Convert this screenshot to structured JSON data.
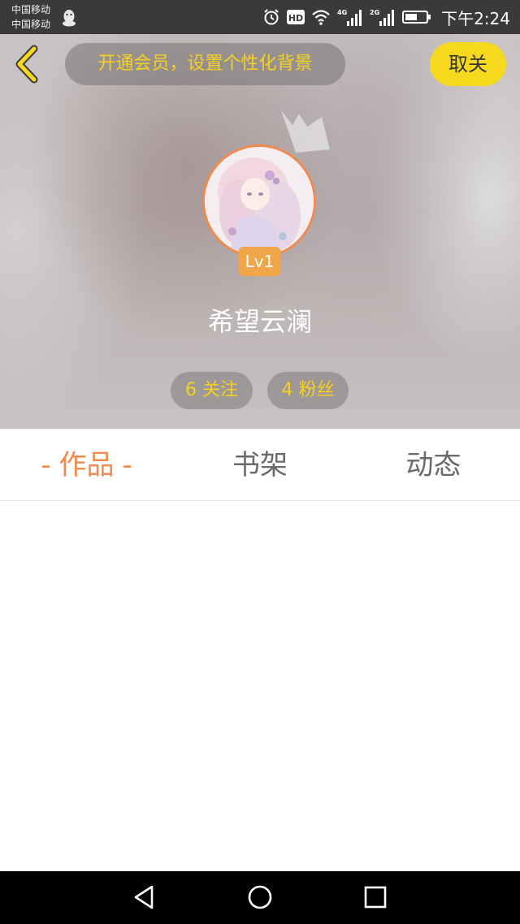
{
  "status_bar": {
    "carrier_1": "中国移动",
    "carrier_2": "中国移动",
    "network_1": "4G",
    "network_2": "2G",
    "hd": "HD",
    "time": "下午2:24"
  },
  "header": {
    "promo_text": "开通会员，设置个性化背景",
    "unfollow_label": "取关",
    "level": "Lv1",
    "username": "希望云澜",
    "following_label": "6 关注",
    "fans_label": "4 粉丝"
  },
  "tabs": [
    {
      "label": "作品",
      "active": true
    },
    {
      "label": "书架",
      "active": false
    },
    {
      "label": "动态",
      "active": false
    }
  ],
  "tab_dash": "-",
  "colors": {
    "accent_orange": "#f08a4e",
    "accent_yellow": "#f6d81d",
    "promo_text": "#f5d21f",
    "badge": "#f2a64a"
  },
  "icons": {
    "back": "chevron-left-icon",
    "crown": "crown-icon",
    "nav_back": "triangle-back-icon",
    "nav_home": "circle-home-icon",
    "nav_recent": "square-recent-icon"
  }
}
